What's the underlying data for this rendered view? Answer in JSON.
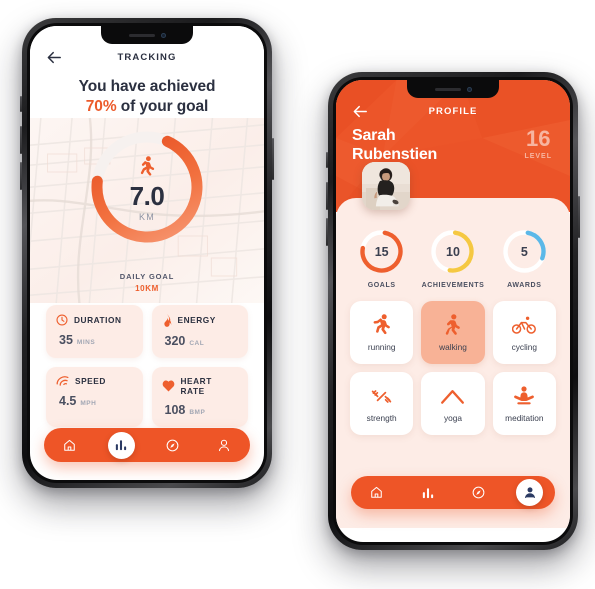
{
  "theme": {
    "accent": "#ee5527",
    "accent_soft": "#fdece6",
    "dark_text": "#2b3040",
    "ring_goals": "#ee5f2e",
    "ring_achievements": "#f5c842",
    "ring_awards": "#5bb8e8"
  },
  "tracking_screen": {
    "nav": {
      "back_icon": "arrow-left-icon",
      "title": "TRACKING"
    },
    "headline": {
      "line1": "You have achieved",
      "percent": "70%",
      "line2_rest": " of your goal"
    },
    "ring": {
      "icon": "walking-person-icon",
      "value": "7.0",
      "unit": "KM",
      "progress_percent": 70
    },
    "goal": {
      "label": "DAILY GOAL",
      "value": "10KM"
    },
    "stats": [
      {
        "icon": "clock-icon",
        "name": "DURATION",
        "value": "35",
        "unit": "MINS"
      },
      {
        "icon": "flame-icon",
        "name": "ENERGY",
        "value": "320",
        "unit": "CAL"
      },
      {
        "icon": "speed-icon",
        "name": "SPEED",
        "value": "4.5",
        "unit": "MPH"
      },
      {
        "icon": "heart-icon",
        "name": "HEART RATE",
        "value": "108",
        "unit": "BMP"
      }
    ],
    "tabbar": [
      {
        "icon": "home-icon",
        "active": false
      },
      {
        "icon": "chart-icon",
        "active": true
      },
      {
        "icon": "compass-icon",
        "active": false
      },
      {
        "icon": "person-icon",
        "active": false
      }
    ]
  },
  "profile_screen": {
    "nav": {
      "back_icon": "arrow-left-icon",
      "title": "PROFILE"
    },
    "user": {
      "name_line1": "Sarah",
      "name_line2": "Rubenstien",
      "avatar": "user-avatar-photo"
    },
    "level": {
      "number": "16",
      "label": "LEVEL"
    },
    "rings": [
      {
        "value": "15",
        "label": "GOALS",
        "percent": 75,
        "color": "#ee5f2e"
      },
      {
        "value": "10",
        "label": "ACHIEVEMENTS",
        "percent": 50,
        "color": "#f5c842"
      },
      {
        "value": "5",
        "label": "AWARDS",
        "percent": 28,
        "color": "#5bb8e8"
      }
    ],
    "activities": [
      {
        "icon": "running-icon",
        "label": "running",
        "selected": false
      },
      {
        "icon": "walking-icon",
        "label": "walking",
        "selected": true
      },
      {
        "icon": "cycling-icon",
        "label": "cycling",
        "selected": false
      },
      {
        "icon": "strength-icon",
        "label": "strength",
        "selected": false
      },
      {
        "icon": "yoga-icon",
        "label": "yoga",
        "selected": false
      },
      {
        "icon": "meditation-icon",
        "label": "meditation",
        "selected": false
      }
    ],
    "tabbar": [
      {
        "icon": "home-icon",
        "active": false
      },
      {
        "icon": "chart-icon",
        "active": false
      },
      {
        "icon": "compass-icon",
        "active": false
      },
      {
        "icon": "person-icon",
        "active": true
      }
    ]
  }
}
